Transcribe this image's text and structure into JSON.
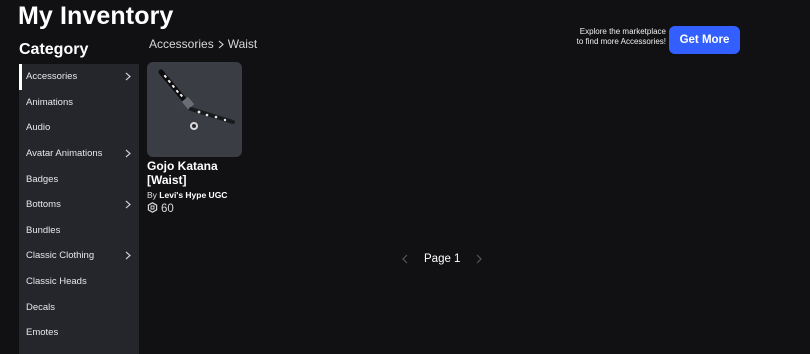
{
  "page_title": "My Inventory",
  "category": {
    "heading": "Category",
    "items": [
      {
        "label": "Accessories",
        "has_submenu": true,
        "active": true
      },
      {
        "label": "Animations",
        "has_submenu": false
      },
      {
        "label": "Audio",
        "has_submenu": false
      },
      {
        "label": "Avatar Animations",
        "has_submenu": true
      },
      {
        "label": "Badges",
        "has_submenu": false
      },
      {
        "label": "Bottoms",
        "has_submenu": true
      },
      {
        "label": "Bundles",
        "has_submenu": false
      },
      {
        "label": "Classic Clothing",
        "has_submenu": true
      },
      {
        "label": "Classic Heads",
        "has_submenu": false
      },
      {
        "label": "Decals",
        "has_submenu": false
      },
      {
        "label": "Emotes",
        "has_submenu": false
      }
    ]
  },
  "breadcrumb": {
    "parent": "Accessories",
    "separator_icon": "chevron-right-icon",
    "current": "Waist"
  },
  "promo": {
    "line1": "Explore the marketplace",
    "line2": "to find more Accessories!",
    "button_label": "Get More"
  },
  "item": {
    "name_line1": "Gojo Katana",
    "name_line2": "[Waist]",
    "creator_prefix": "By",
    "creator": "Levi's Hype UGC",
    "price_icon": "robux-icon",
    "price": "60"
  },
  "pagination": {
    "label": "Page 1"
  },
  "colors": {
    "background": "#111114",
    "sidebar": "#24262b",
    "accent": "#335fff",
    "thumbnail_bg": "#3b3d44"
  }
}
